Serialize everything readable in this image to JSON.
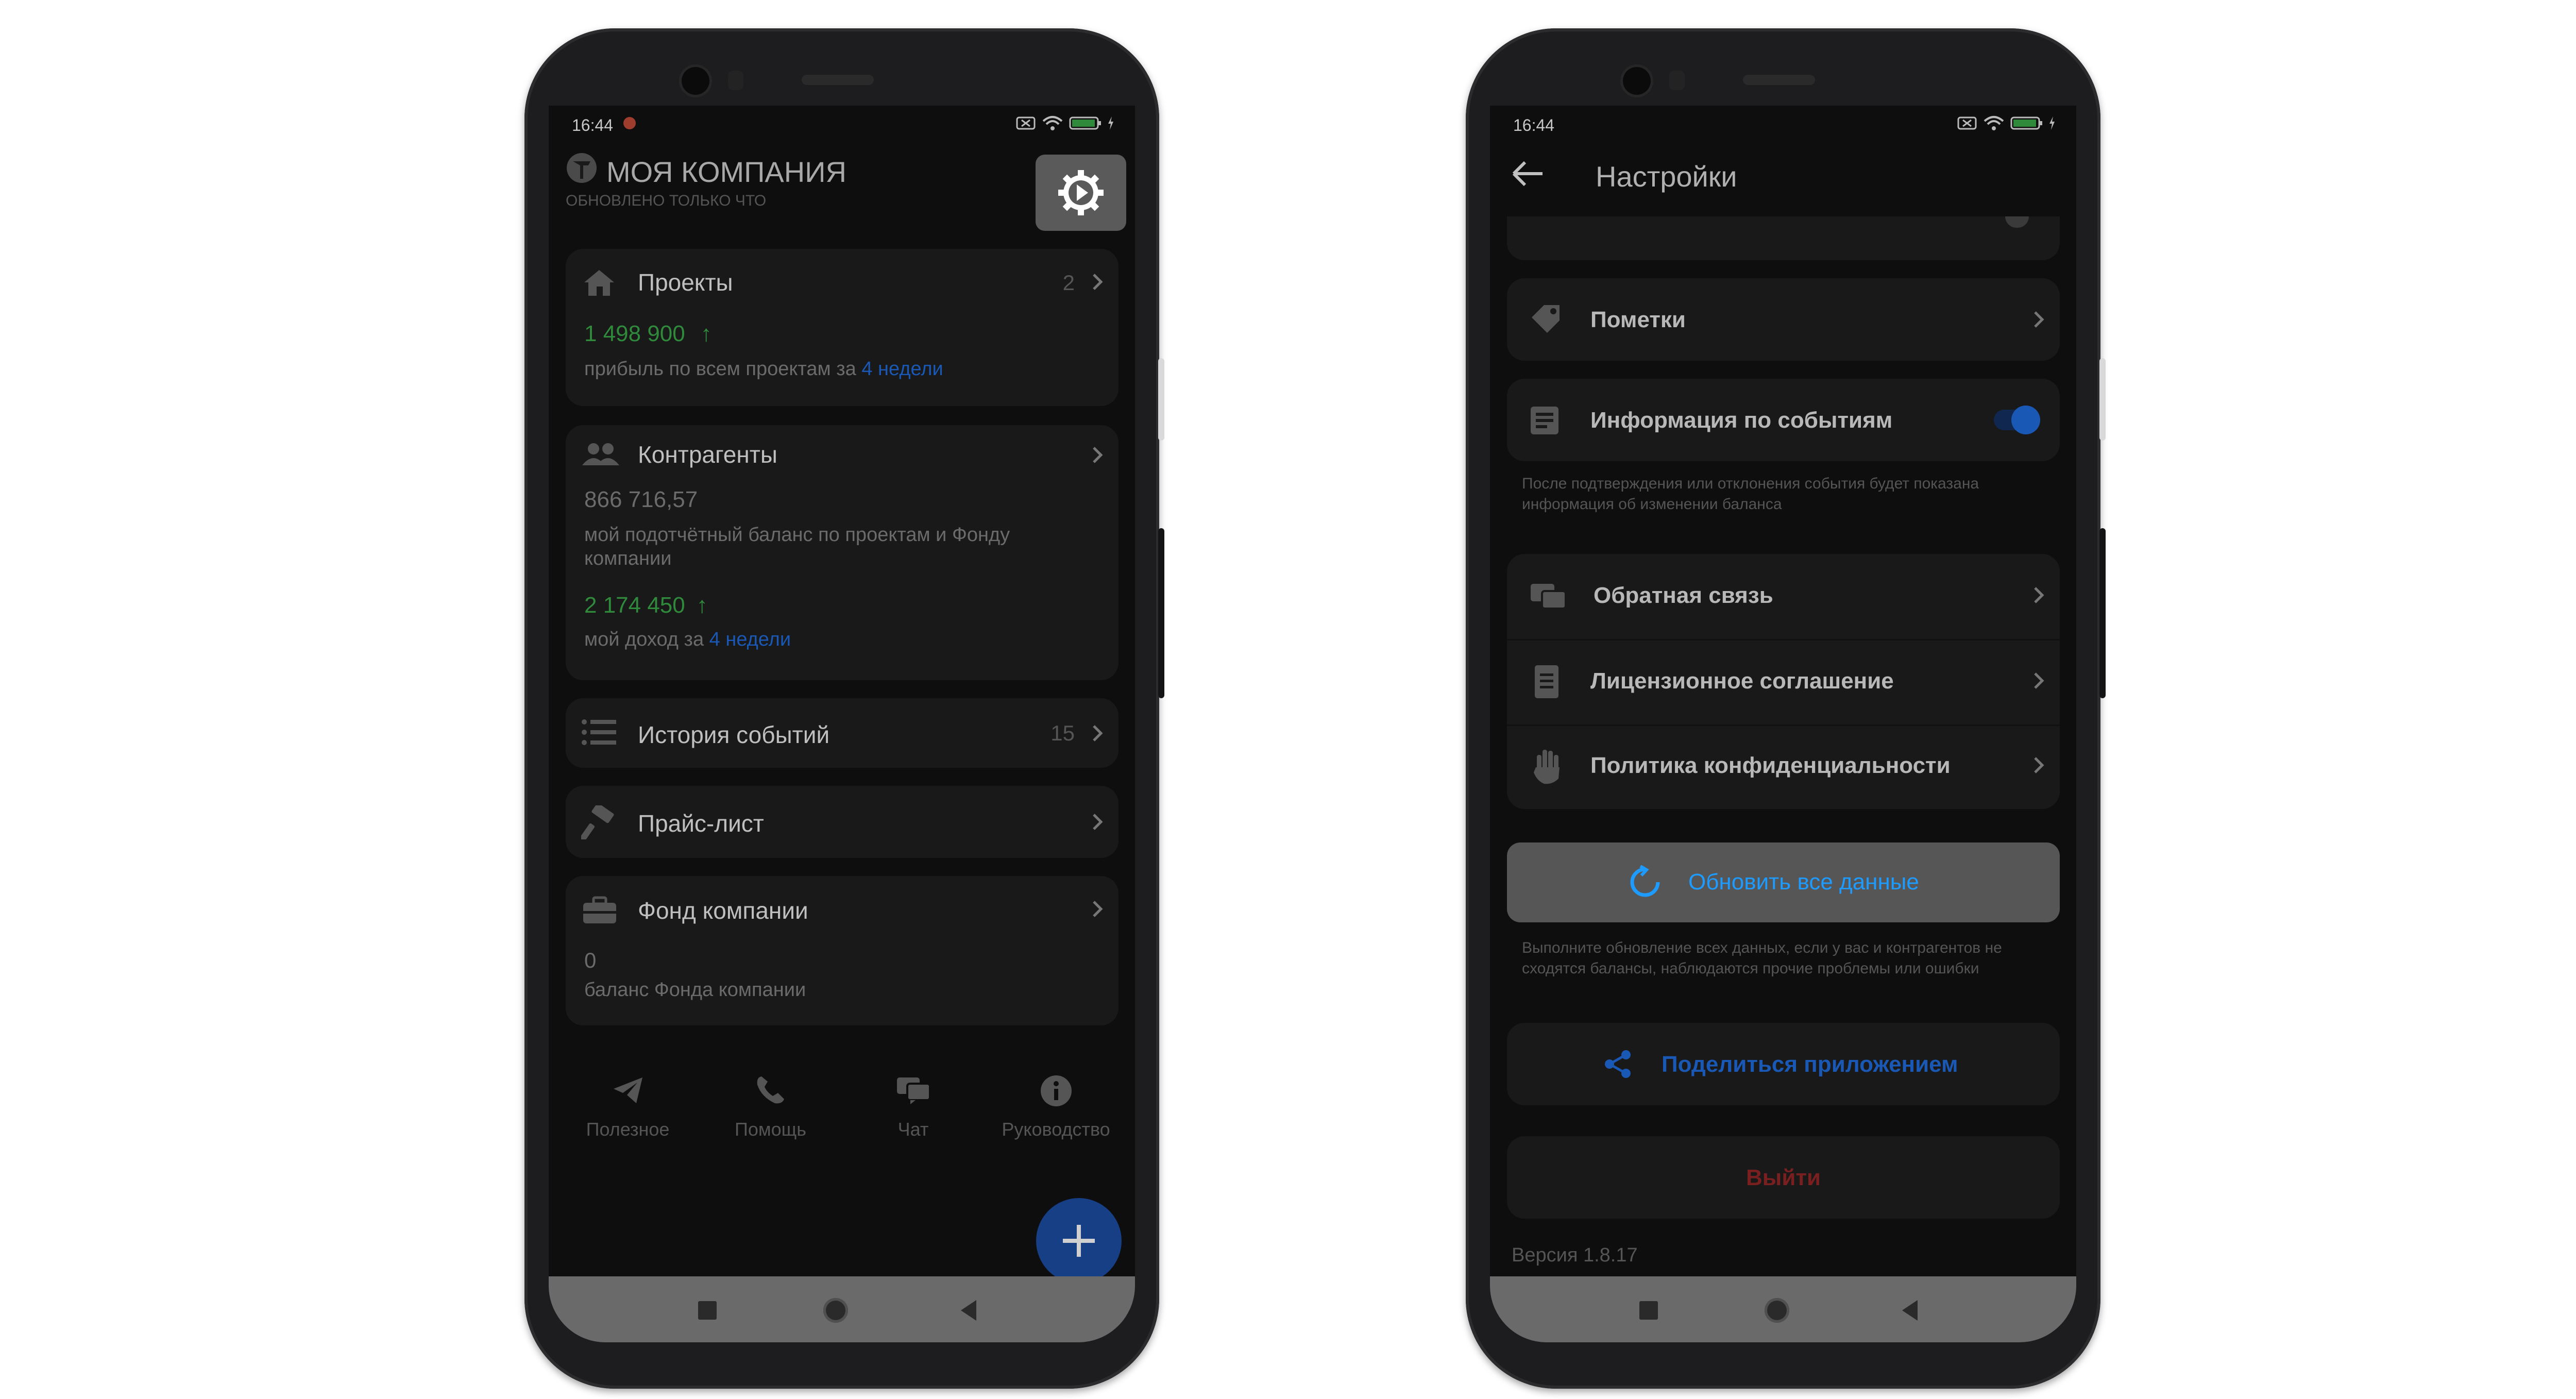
{
  "left_screen": {
    "status_time": "16:44",
    "company_title": "МОЯ КОМПАНИЯ",
    "updated_text": "ОБНОВЛЕНО ТОЛЬКО ЧТО",
    "cards": {
      "projects": {
        "title": "Проекты",
        "count": "2",
        "value": "1 498 900",
        "caption": "прибыль по всем проектам за",
        "period": "4 недели"
      },
      "contractors": {
        "title": "Контрагенты",
        "balance": "866 716,57",
        "balance_caption": "мой подотчётный баланс по проектам и Фонду компании",
        "income": "2 174 450",
        "income_caption": "мой доход за",
        "period": "4 недели"
      },
      "history": {
        "title": "История событий",
        "count": "15"
      },
      "pricelist": {
        "title": "Прайс-лист"
      },
      "fund": {
        "title": "Фонд компании",
        "value": "0",
        "caption": "баланс Фонда компании"
      }
    },
    "bottom_nav": [
      {
        "label": "Полезное",
        "icon": "telegram-icon"
      },
      {
        "label": "Помощь",
        "icon": "phone-icon"
      },
      {
        "label": "Чат",
        "icon": "chat-icon"
      },
      {
        "label": "Руководство",
        "icon": "info-icon"
      }
    ]
  },
  "right_screen": {
    "status_time": "16:44",
    "header_title": "Настройки",
    "items": {
      "tags": "Пометки",
      "event_info": "Информация по событиям",
      "event_info_hint": "После подтверждения или отклонения события будет показана информация об изменении баланса",
      "feedback": "Обратная связь",
      "license": "Лицензионное соглашение",
      "privacy": "Политика конфиденциальности"
    },
    "refresh_button": "Обновить все данные",
    "refresh_hint": "Выполните обновление всех данных, если у вас и контрагентов не сходятся балансы, наблюдаются прочие проблемы или ошибки",
    "share_button": "Поделиться приложением",
    "logout_button": "Выйти",
    "version": "Версия 1.8.17",
    "event_info_enabled": true
  },
  "colors": {
    "accent_blue": "#1a58b5",
    "positive_green": "#2f8a3c",
    "logout_red": "#7a1f1f",
    "refresh_text": "#1e9bff"
  }
}
